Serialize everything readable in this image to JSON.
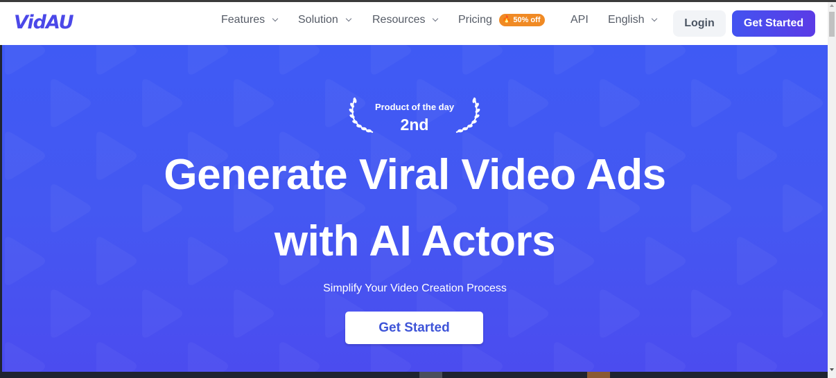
{
  "brand": {
    "name": "VidAU",
    "color": "#4b48e8"
  },
  "nav": {
    "items": [
      {
        "label": "Features",
        "has_dropdown": true
      },
      {
        "label": "Solution",
        "has_dropdown": true
      },
      {
        "label": "Resources",
        "has_dropdown": true
      },
      {
        "label": "Pricing",
        "has_dropdown": false,
        "badge": "50% off",
        "badge_icon": "flame-icon"
      },
      {
        "label": "API",
        "has_dropdown": false
      },
      {
        "label": "English",
        "has_dropdown": true
      }
    ],
    "login_label": "Login",
    "cta_label": "Get Started"
  },
  "hero": {
    "award": {
      "label": "Product of the day",
      "rank": "2nd"
    },
    "headline_line1": "Generate Viral Video Ads",
    "headline_line2": "with AI Actors",
    "subtitle": "Simplify Your Video Creation Process",
    "cta_label": "Get Started"
  },
  "colors": {
    "accent": "#4b48e8",
    "hero_bg": "#4458f2",
    "badge": "#f08a24",
    "cta_gradient_start": "#4353f0",
    "cta_gradient_end": "#5b3be6"
  }
}
